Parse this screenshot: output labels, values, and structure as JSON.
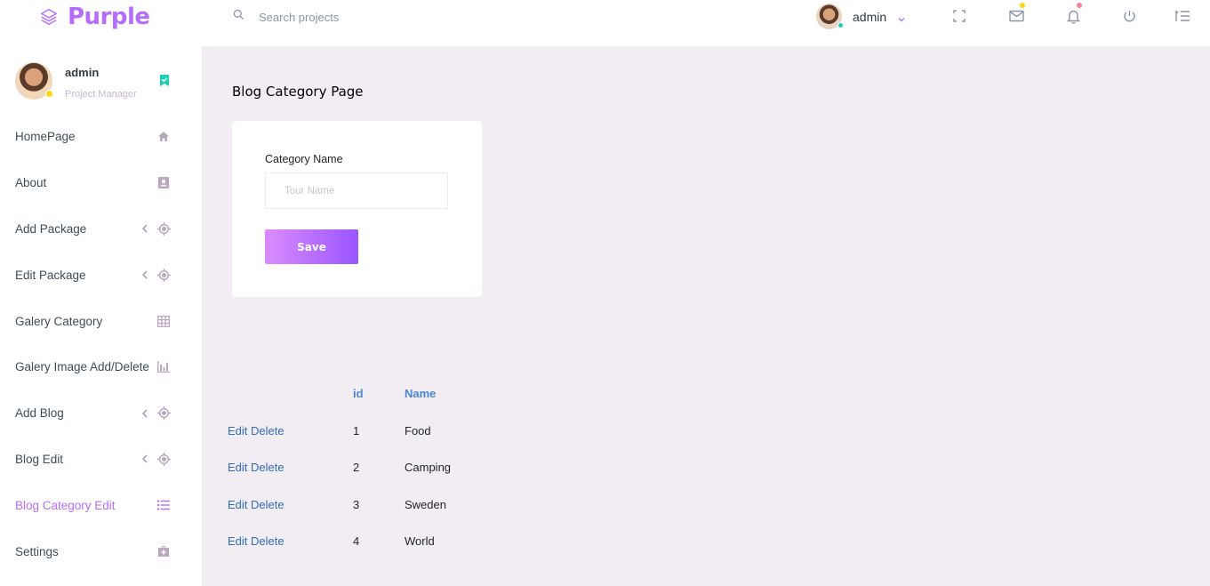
{
  "brand": {
    "name": "Purple",
    "accent": "#b66dff"
  },
  "search": {
    "placeholder": "Search projects"
  },
  "navbar": {
    "user_name": "admin",
    "icons": [
      "fullscreen-icon",
      "mail-icon",
      "bell-icon",
      "power-icon",
      "menu-toggle-icon"
    ]
  },
  "sidebar": {
    "profile": {
      "name": "admin",
      "role": "Project Manager"
    },
    "items": [
      {
        "label": "HomePage",
        "icon": "home-icon",
        "has_arrow": false
      },
      {
        "label": "About",
        "icon": "contact-card-icon",
        "has_arrow": false
      },
      {
        "label": "Add Package",
        "icon": "crosshair-icon",
        "has_arrow": true
      },
      {
        "label": "Edit Package",
        "icon": "crosshair-icon",
        "has_arrow": true
      },
      {
        "label": "Galery Category",
        "icon": "grid-icon",
        "has_arrow": false
      },
      {
        "label": "Galery Image Add/Delete",
        "icon": "chart-icon",
        "has_arrow": false
      },
      {
        "label": "Add Blog",
        "icon": "crosshair-icon",
        "has_arrow": true
      },
      {
        "label": "Blog Edit",
        "icon": "crosshair-icon",
        "has_arrow": true
      },
      {
        "label": "Blog Category Edit",
        "icon": "list-icon",
        "has_arrow": false,
        "active": true
      },
      {
        "label": "Settings",
        "icon": "medical-bag-icon",
        "has_arrow": false
      }
    ]
  },
  "main": {
    "title": "Blog Category Page",
    "form": {
      "label": "Category Name",
      "placeholder": "Tour Name",
      "value": "",
      "save_label": "Save"
    },
    "table": {
      "headers": {
        "id": "id",
        "name": "Name"
      },
      "action_edit": "Edit",
      "action_delete": "Delete",
      "rows": [
        {
          "id": "1",
          "name": "Food"
        },
        {
          "id": "2",
          "name": "Camping"
        },
        {
          "id": "3",
          "name": "Sweden"
        },
        {
          "id": "4",
          "name": "World"
        }
      ]
    }
  }
}
